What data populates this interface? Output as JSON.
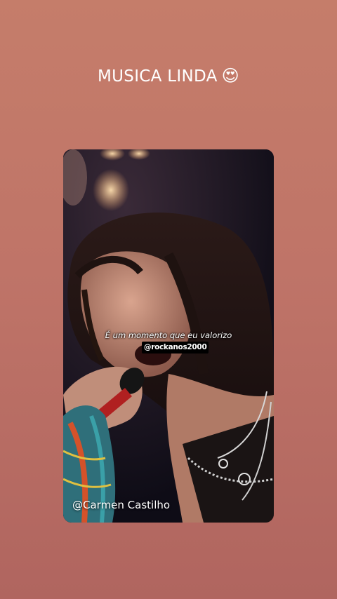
{
  "story": {
    "title": "MUSICA LINDA",
    "title_emoji": "😍"
  },
  "video": {
    "subtitle": "É um momento que eu valorizo",
    "handle_tag": "@rockanos2000",
    "credit": "@Carmen Castilho"
  },
  "colors": {
    "background_top": "#c57d6a",
    "background_bottom": "#b0655f",
    "text": "#ffffff"
  }
}
